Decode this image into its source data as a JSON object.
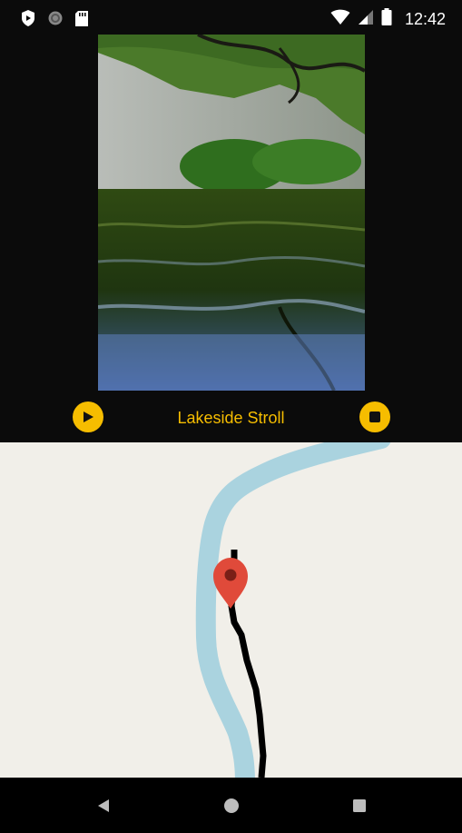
{
  "status_bar": {
    "time": "12:42",
    "icons": [
      "play-protect-icon",
      "sync-circle-icon",
      "sd-card-icon",
      "wifi-icon",
      "cell-signal-icon",
      "battery-icon"
    ]
  },
  "player": {
    "title": "Lakeside Stroll",
    "play_icon": "play-icon",
    "stop_icon": "stop-icon",
    "accent_color": "#f6bd00"
  },
  "map": {
    "marker_icon": "map-pin-icon",
    "river_color": "#aad3df",
    "track_color": "#000000",
    "background_color": "#f1efe9"
  },
  "nav_bar": {
    "icons": [
      "back-icon",
      "home-icon",
      "recents-icon"
    ]
  }
}
